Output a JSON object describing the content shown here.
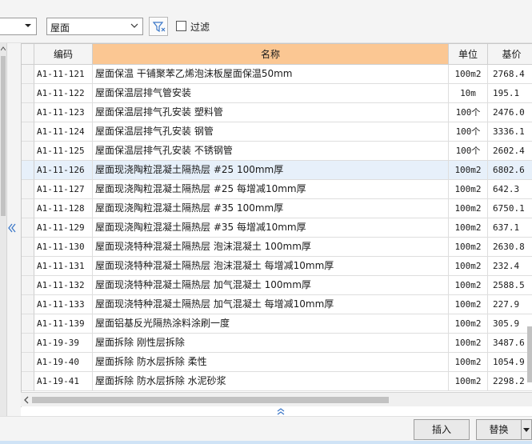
{
  "toolbar": {
    "left_combo_value": "",
    "category_combo_value": "屋面",
    "filter_checkbox_label": "过滤",
    "filter_checked": false
  },
  "columns": {
    "code": "编码",
    "name": "名称",
    "unit": "单位",
    "price": "基价"
  },
  "rows": [
    {
      "code": "A1-11-121",
      "name": "屋面保温 干铺聚苯乙烯泡沫板屋面保温50mm",
      "unit": "100m2",
      "price": "2768.4"
    },
    {
      "code": "A1-11-122",
      "name": "屋面保温层排气管安装",
      "unit": "10m",
      "price": "195.1"
    },
    {
      "code": "A1-11-123",
      "name": "屋面保温层排气孔安装 塑料管",
      "unit": "100个",
      "price": "2476.0"
    },
    {
      "code": "A1-11-124",
      "name": "屋面保温层排气孔安装 钢管",
      "unit": "100个",
      "price": "3336.1"
    },
    {
      "code": "A1-11-125",
      "name": "屋面保温层排气孔安装 不锈钢管",
      "unit": "100个",
      "price": "2602.4"
    },
    {
      "code": "A1-11-126",
      "name": "屋面现浇陶粒混凝土隔热层 #25 100mm厚",
      "unit": "100m2",
      "price": "6802.6"
    },
    {
      "code": "A1-11-127",
      "name": "屋面现浇陶粒混凝土隔热层 #25 每增减10mm厚",
      "unit": "100m2",
      "price": "642.3"
    },
    {
      "code": "A1-11-128",
      "name": "屋面现浇陶粒混凝土隔热层 #35 100mm厚",
      "unit": "100m2",
      "price": "6750.1"
    },
    {
      "code": "A1-11-129",
      "name": "屋面现浇陶粒混凝土隔热层 #35 每增减10mm厚",
      "unit": "100m2",
      "price": "637.1"
    },
    {
      "code": "A1-11-130",
      "name": "屋面现浇特种混凝土隔热层 泡沫混凝土 100mm厚",
      "unit": "100m2",
      "price": "2630.8"
    },
    {
      "code": "A1-11-131",
      "name": "屋面现浇特种混凝土隔热层 泡沫混凝土 每增减10mm厚",
      "unit": "100m2",
      "price": "232.4"
    },
    {
      "code": "A1-11-132",
      "name": "屋面现浇特种混凝土隔热层 加气混凝土 100mm厚",
      "unit": "100m2",
      "price": "2588.5"
    },
    {
      "code": "A1-11-133",
      "name": "屋面现浇特种混凝土隔热层 加气混凝土 每增减10mm厚",
      "unit": "100m2",
      "price": "227.9"
    },
    {
      "code": "A1-11-139",
      "name": "屋面铝基反光隔热涂料涂刷一度",
      "unit": "100m2",
      "price": "305.9"
    },
    {
      "code": "A1-19-39",
      "name": "屋面拆除 刚性层拆除",
      "unit": "100m2",
      "price": "3487.6"
    },
    {
      "code": "A1-19-40",
      "name": "屋面拆除 防水层拆除 柔性",
      "unit": "100m2",
      "price": "1054.9"
    },
    {
      "code": "A1-19-41",
      "name": "屋面拆除 防水层拆除 水泥砂浆",
      "unit": "100m2",
      "price": "2298.2"
    }
  ],
  "selected_row": 5,
  "buttons": {
    "insert": "插入",
    "replace": "替换"
  },
  "icons": {
    "dropdown": "chevron-down-icon",
    "filter": "funnel-icon",
    "collapse": "double-chevron-left-icon",
    "split": "double-chevron-up-icon"
  },
  "colors": {
    "header_highlight": "#fbc793",
    "selected_row": "#e7f0fa",
    "accent_line": "#cfe3f6"
  }
}
